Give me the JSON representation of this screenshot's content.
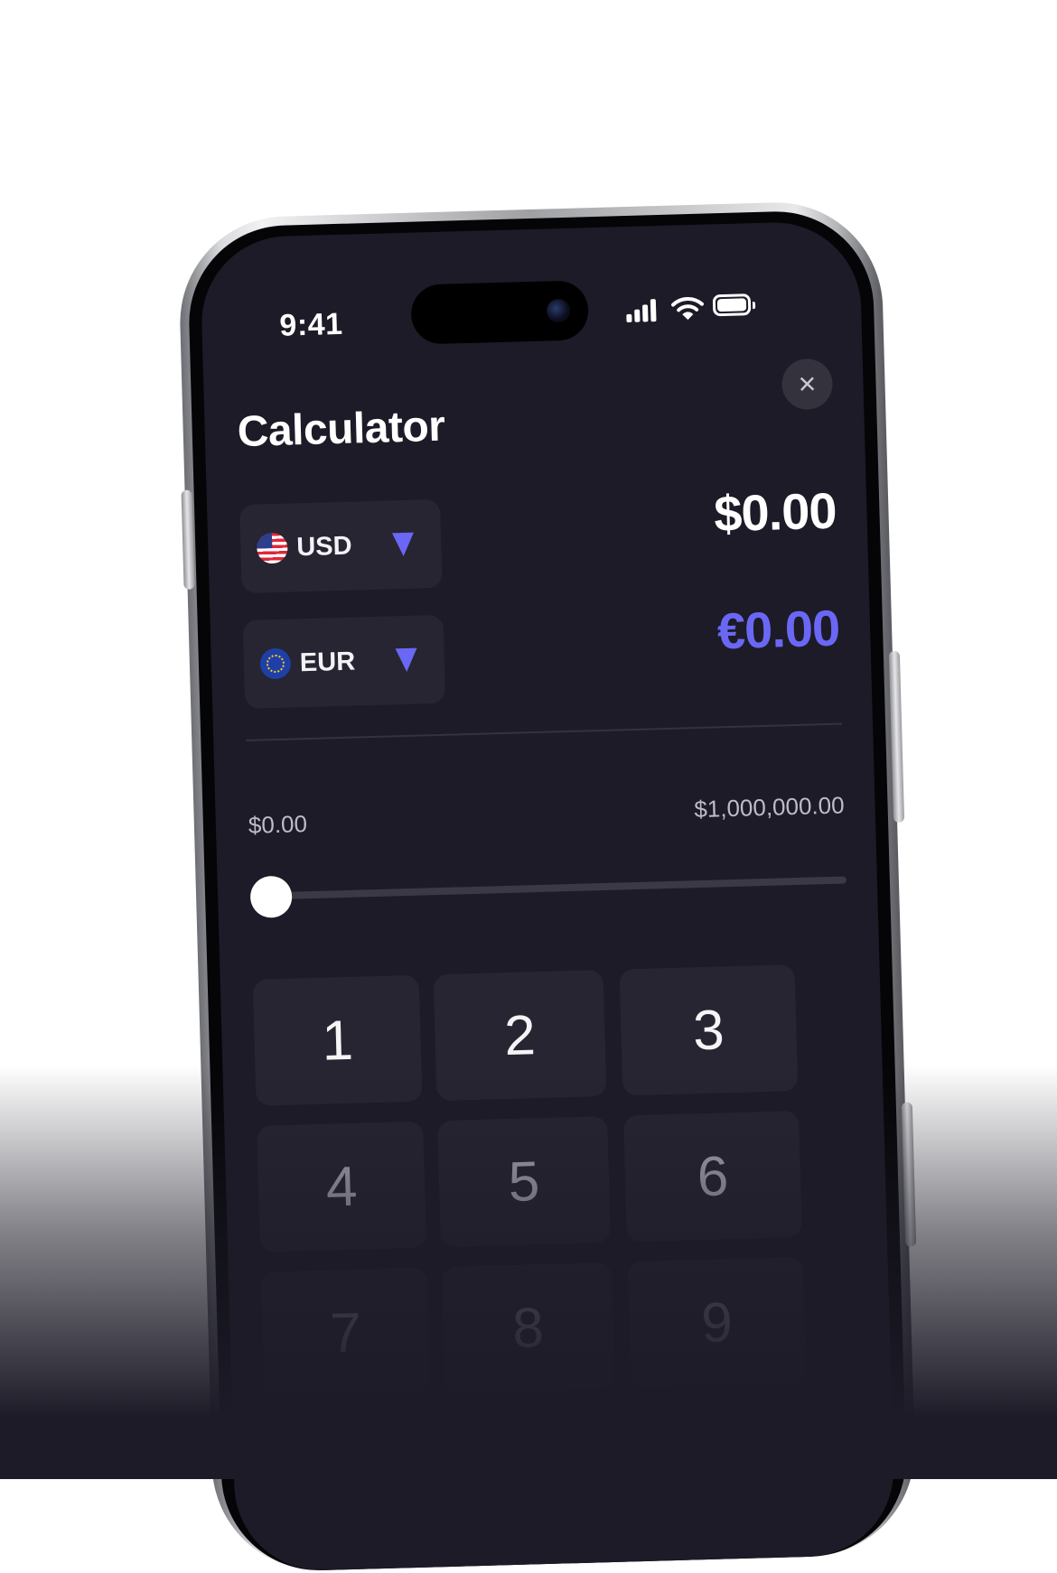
{
  "status_bar": {
    "time": "9:41"
  },
  "header": {
    "title": "Calculator",
    "close_icon": "×"
  },
  "conversion": {
    "from": {
      "code": "USD",
      "flag": "us-flag-icon",
      "amount": "$0.00"
    },
    "to": {
      "code": "EUR",
      "flag": "eu-flag-icon",
      "amount": "€0.00"
    }
  },
  "slider": {
    "min_label": "$0.00",
    "max_label": "$1,000,000.00",
    "value": 0
  },
  "keypad": {
    "keys": [
      "1",
      "2",
      "3",
      "4",
      "5",
      "6",
      "7",
      "8",
      "9"
    ]
  },
  "colors": {
    "accent": "#6b67f5",
    "screen_bg": "#1c1b27",
    "card_bg": "#262531"
  }
}
